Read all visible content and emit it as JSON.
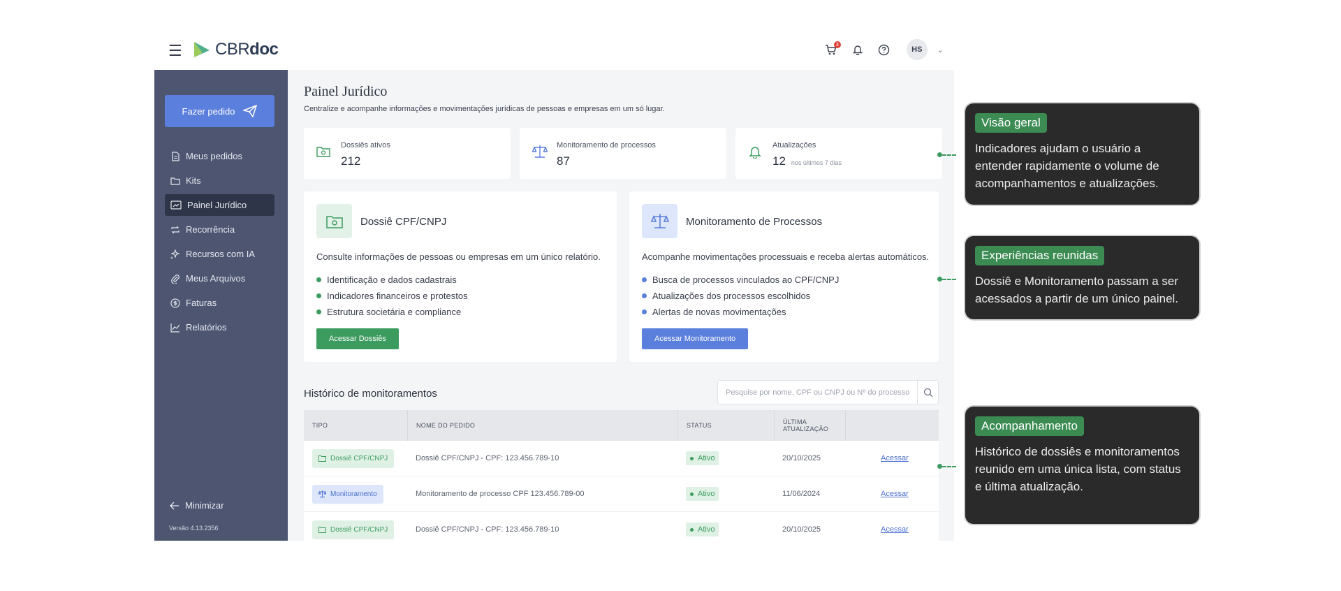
{
  "brand": {
    "name_regular": "CBR",
    "name_bold": "doc"
  },
  "topbar": {
    "cart_count": "3",
    "avatar_initials": "HS"
  },
  "sidebar": {
    "order_button": "Fazer pedido",
    "items": [
      {
        "label": "Meus pedidos",
        "icon": "document-icon"
      },
      {
        "label": "Kits",
        "icon": "folder-icon"
      },
      {
        "label": "Painel Jurídico",
        "icon": "dashboard-icon",
        "active": true
      },
      {
        "label": "Recorrência",
        "icon": "repeat-icon"
      },
      {
        "label": "Recursos com IA",
        "icon": "sparkle-icon"
      },
      {
        "label": "Meus Arquivos",
        "icon": "paperclip-icon"
      },
      {
        "label": "Faturas",
        "icon": "dollar-icon"
      },
      {
        "label": "Relatórios",
        "icon": "chart-icon"
      }
    ],
    "minimize": "Minimizar",
    "version": "Versão 4.13.2356"
  },
  "page": {
    "title": "Painel Jurídico",
    "subtitle": "Centralize e acompanhe informações e movimentações jurídicas de pessoas e empresas em um só lugar."
  },
  "stats": [
    {
      "label": "Dossiês ativos",
      "value": "212",
      "extra": ""
    },
    {
      "label": "Monitoramento de processos",
      "value": "87",
      "extra": ""
    },
    {
      "label": "Atualizações",
      "value": "12",
      "extra": "nos últimos 7 dias"
    }
  ],
  "cards": {
    "dossie": {
      "title": "Dossiê CPF/CNPJ",
      "description": "Consulte informações de pessoas ou empresas em um único relatório.",
      "bullets": [
        "Identificação e dados cadastrais",
        "Indicadores financeiros e protestos",
        "Estrutura societária e compliance"
      ],
      "button": "Acessar Dossiês"
    },
    "monitoramento": {
      "title": "Monitoramento de Processos",
      "description": "Acompanhe movimentações processuais e receba alertas automáticos.",
      "bullets": [
        "Busca de processos vinculados ao CPF/CNPJ",
        "Atualizações dos processos escolhidos",
        "Alertas de novas movimentações"
      ],
      "button": "Acessar Monitoramento"
    }
  },
  "history": {
    "title": "Histórico de monitoramentos",
    "search_placeholder": "Pesquise por nome, CPF ou CNPJ ou Nº do processo",
    "columns": [
      "TIPO",
      "NOME DO PEDIDO",
      "STATUS",
      "ÚLTIMA ATUALIZAÇÃO",
      ""
    ],
    "rows": [
      {
        "type": "Dossiê CPF/CNPJ",
        "name": "Dossiê CPF/CNPJ - CPF: 123.456.789-10",
        "status": "Ativo",
        "date": "20/10/2025",
        "action": "Acessar"
      },
      {
        "type": "Monitoramento",
        "name": "Monitoramento de processo CPF 123.456.789-00",
        "status": "Ativo",
        "date": "11/06/2024",
        "action": "Acessar"
      },
      {
        "type": "Dossiê CPF/CNPJ",
        "name": "Dossiê CPF/CNPJ - CPF: 123.456.789-10",
        "status": "Ativo",
        "date": "20/10/2025",
        "action": "Acessar"
      }
    ]
  },
  "annotations": [
    {
      "heading": "Visão geral",
      "body": "Indicadores ajudam o usuário a entender rapidamente o volume de acompanhamentos e atualizações."
    },
    {
      "heading": "Experiências reunidas",
      "body": "Dossiê e Monitoramento passam a ser acessados a partir de um único painel."
    },
    {
      "heading": "Acompanhamento",
      "body": "Histórico de dossiês e monitoramentos reunido em uma única lista, com status e última atualização."
    }
  ],
  "colors": {
    "sidebar": "#4d5571",
    "primary_blue": "#5b7fdc",
    "green": "#3c9b5f",
    "annotation_bg": "#2a2a2a"
  }
}
